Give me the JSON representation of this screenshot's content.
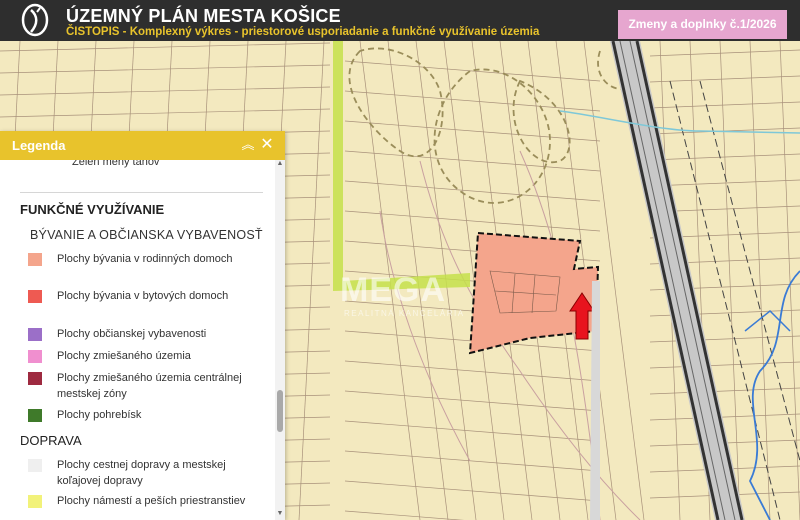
{
  "header": {
    "title": "ÚZEMNÝ PLÁN MESTA KOŠICE",
    "subtitle": "ČISTOPIS - Komplexný výkres - priestorové usporiadanie a funkčné využívanie územia",
    "changes_button": "Zmeny a doplnky č.1/2026",
    "logo_icon": "city-emblem-icon"
  },
  "legend": {
    "title": "Legenda",
    "collapse_icon": "chevron-double-up-icon",
    "close_icon": "close-icon",
    "cut_item": "Zeleň mený tánov",
    "sections": [
      {
        "title": "FUNKČNÉ VYUŽÍVANIE",
        "subsections": [
          {
            "title": "BÝVANIE A OBČIANSKA VYBAVENOSŤ",
            "items": [
              {
                "label": "Plochy bývania v rodinných domoch",
                "color": "#f4a58c"
              },
              {
                "label": "Plochy bývania v bytových domoch",
                "color": "#ee5a52"
              },
              {
                "label": "Plochy občianskej vybavenosti",
                "color": "#9b6fc8"
              },
              {
                "label": "Plochy zmiešaného územia",
                "color": "#f08fcf"
              },
              {
                "label": "Plochy zmiešaného územia centrálnej mestskej zóny",
                "color": "#9e2a40"
              },
              {
                "label": "Plochy pohrebísk",
                "color": "#3f7a2a"
              }
            ]
          }
        ]
      },
      {
        "title": "DOPRAVA",
        "items": [
          {
            "label": "Plochy cestnej dopravy a mestskej koľajovej dopravy",
            "color": "#efefef"
          },
          {
            "label": "Plochy námestí a peších priestranstiev",
            "color": "#f2f27a"
          }
        ]
      }
    ]
  },
  "map": {
    "watermark": "MEGA",
    "watermark_sub": "REALITNÁ KANCELÁRIA",
    "colors": {
      "base": "#f3e9bf",
      "parcel_line": "#a8917a",
      "green_strip": "#c4e04a",
      "highlight": "#f4a58c",
      "rail": "#333333",
      "water": "#3a7bd5"
    },
    "marker_icon": "red-arrow-up-icon"
  }
}
